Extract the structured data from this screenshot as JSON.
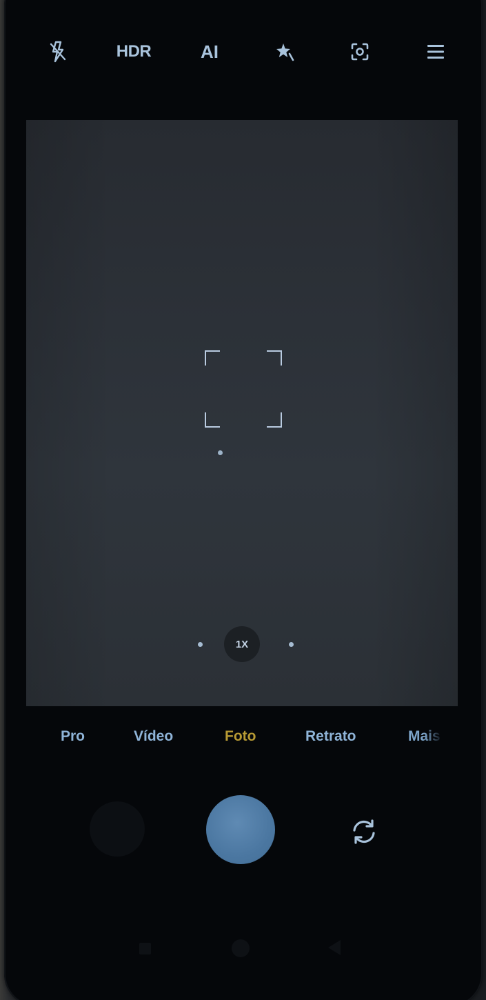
{
  "top_bar": {
    "flash_icon": "flash-off-icon",
    "hdr_label": "HDR",
    "ai_label": "AI",
    "beauty_icon": "magic-star-icon",
    "lens_icon": "google-lens-icon",
    "menu_icon": "hamburger-menu-icon"
  },
  "viewfinder": {
    "focus_icon": "focus-frame-icon"
  },
  "zoom": {
    "current": "1X"
  },
  "modes": {
    "items": [
      "Pro",
      "Vídeo",
      "Foto",
      "Retrato",
      "Mais"
    ],
    "active": "Foto"
  },
  "controls": {
    "shutter_icon": "shutter-icon",
    "switch_icon": "switch-camera-icon"
  },
  "colors": {
    "accent_active": "#b79a34",
    "icon_tint": "#a9c3dc",
    "shutter": "#4b77a1"
  }
}
